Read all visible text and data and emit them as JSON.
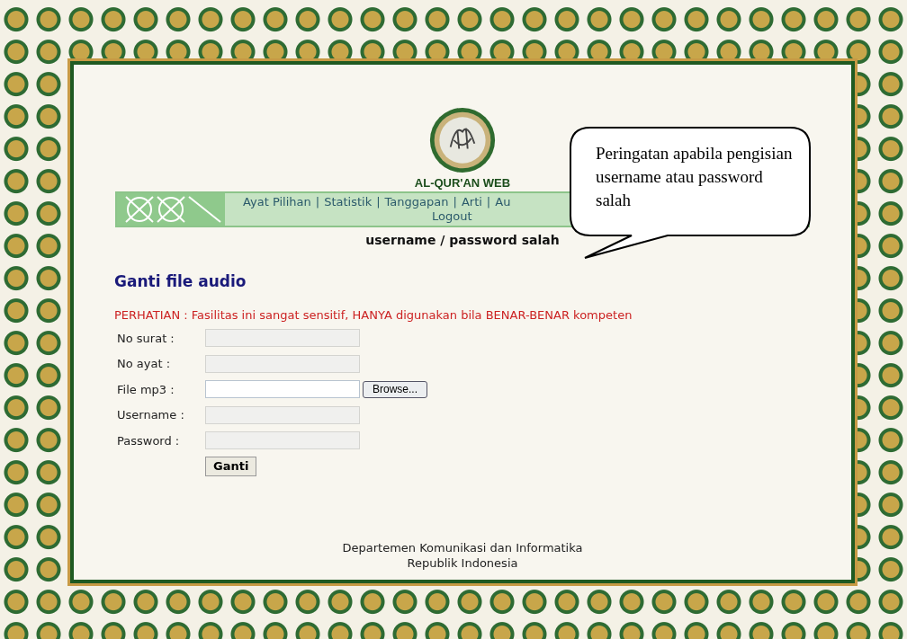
{
  "site_title": "AL-QUR'AN WEB",
  "nav": {
    "separator": "|",
    "links": [
      "Ayat Pilihan",
      "Statistik",
      "Tanggapan",
      "Arti",
      "Au"
    ],
    "second_line": "Logout"
  },
  "error_message": "username / password salah",
  "callout": {
    "text": "Peringatan apabila pengisian username atau password salah"
  },
  "heading": "Ganti file audio",
  "warning": "PERHATIAN : Fasilitas ini sangat sensitif, HANYA digunakan bila BENAR-BENAR kompeten",
  "form": {
    "fields": [
      {
        "label": "No surat :",
        "kind": "text",
        "disabled": true
      },
      {
        "label": "No ayat :",
        "kind": "text",
        "disabled": true
      },
      {
        "label": "File mp3 :",
        "kind": "file",
        "disabled": false,
        "button": "Browse..."
      },
      {
        "label": "Username :",
        "kind": "text",
        "disabled": true
      },
      {
        "label": "Password :",
        "kind": "password",
        "disabled": true
      }
    ],
    "submit": "Ganti"
  },
  "footer": [
    "Departemen Komunikasi dan Informatika",
    "Republik Indonesia"
  ]
}
